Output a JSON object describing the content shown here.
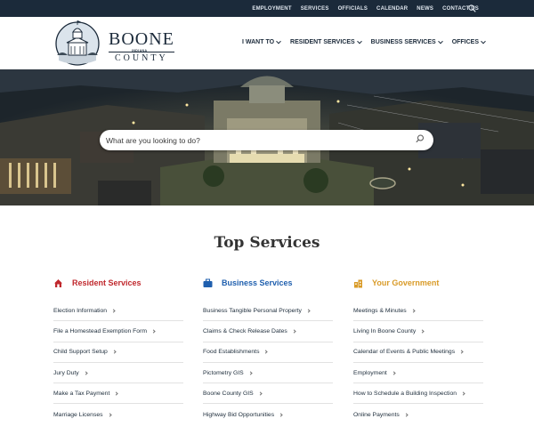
{
  "colors": {
    "navy": "#1b2a3a",
    "resident": "#c0282d",
    "business": "#1f5fae",
    "government": "#d99b28"
  },
  "top_nav": [
    "EMPLOYMENT",
    "SERVICES",
    "OFFICIALS",
    "CALENDAR",
    "NEWS",
    "CONTACT US"
  ],
  "logo": {
    "name": "BOONE",
    "state": "INDIANA",
    "county": "COUNTY"
  },
  "main_nav": [
    "I WANT TO",
    "RESIDENT SERVICES",
    "BUSINESS SERVICES",
    "OFFICES"
  ],
  "search": {
    "placeholder": "What are you looking to do?"
  },
  "section_title": "Top Services",
  "columns": [
    {
      "title": "Resident Services",
      "icon": "house-icon",
      "links": [
        "Election Information",
        "File a Homestead Exemption Form",
        "Child Support Setup",
        "Jury Duty",
        "Make a Tax Payment",
        "Marriage Licenses"
      ]
    },
    {
      "title": "Business Services",
      "icon": "briefcase-icon",
      "links": [
        "Business Tangible Personal Property",
        "Claims & Check Release Dates",
        "Food Establishments",
        "Pictometry GIS",
        "Boone County GIS",
        "Highway Bid Opportunities"
      ]
    },
    {
      "title": "Your Government",
      "icon": "courthouse-icon",
      "links": [
        "Meetings & Minutes",
        "Living In Boone County",
        "Calendar of Events & Public Meetings",
        "Employment",
        "How to Schedule a Building Inspection",
        "Online Payments"
      ]
    }
  ]
}
